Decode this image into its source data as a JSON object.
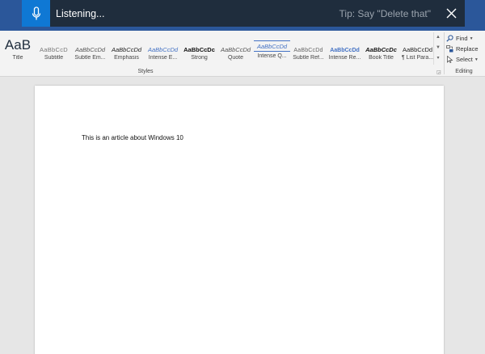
{
  "dictation": {
    "status": "Listening...",
    "tip": "Tip: Say \"Delete that\"",
    "mic_icon": "microphone-icon",
    "close_icon": "close-icon",
    "accent": "#0f78d4",
    "bar_bg": "#1f2d3d"
  },
  "ribbon": {
    "styles": [
      {
        "name": "Title",
        "preview": "AaB",
        "kind": "title"
      },
      {
        "name": "Subtitle",
        "preview": "AaBbCcD",
        "kind": "subtitle"
      },
      {
        "name": "Subtle Em...",
        "preview": "AaBbCcDd",
        "kind": "subtle-em"
      },
      {
        "name": "Emphasis",
        "preview": "AaBbCcDd",
        "kind": "emphasis"
      },
      {
        "name": "Intense E...",
        "preview": "AaBbCcDd",
        "kind": "intense-e"
      },
      {
        "name": "Strong",
        "preview": "AaBbCcDc",
        "kind": "strong"
      },
      {
        "name": "Quote",
        "preview": "AaBbCcDd",
        "kind": "quote"
      },
      {
        "name": "Intense Q...",
        "preview": "AaBbCcDd",
        "kind": "intense-q"
      },
      {
        "name": "Subtle Ref...",
        "preview": "AaBbCcDd",
        "kind": "subtle-ref"
      },
      {
        "name": "Intense Re...",
        "preview": "AaBbCcDd",
        "kind": "intense-re"
      },
      {
        "name": "Book Title",
        "preview": "AaBbCcDc",
        "kind": "book-title"
      },
      {
        "name": "¶ List Para...",
        "preview": "AaBbCcDd",
        "kind": "list-para"
      }
    ],
    "styles_group_label": "Styles",
    "editing": {
      "find": "Find",
      "replace": "Replace",
      "select": "Select",
      "group_label": "Editing"
    }
  },
  "document": {
    "text": "This is an article about Windows 10"
  }
}
